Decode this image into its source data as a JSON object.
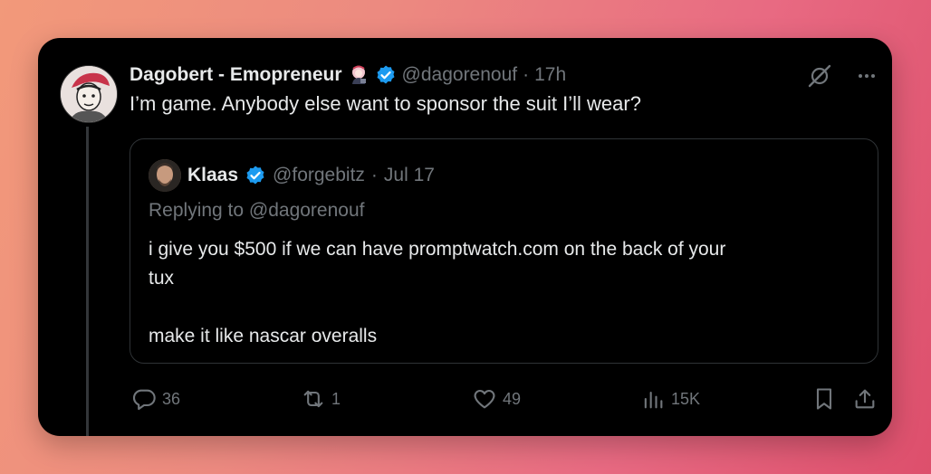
{
  "tweet": {
    "author_name": "Dagobert - Emopreneur",
    "handle": "@dagorenouf",
    "separator": "·",
    "time": "17h",
    "text": "I’m game. Anybody else want to sponsor the suit I’ll wear?"
  },
  "quote": {
    "author_name": "Klaas",
    "handle": "@forgebitz",
    "separator": "·",
    "date": "Jul 17",
    "replying_to": "Replying to @dagorenouf",
    "text_line1": "i give you $500 if we can have promptwatch.com on the back of your",
    "text_line2": "tux",
    "text_line3": "make it like nascar overalls"
  },
  "actions": {
    "replies": "36",
    "reposts": "1",
    "likes": "49",
    "views": "15K"
  },
  "icons": {
    "verified": "verified-badge-icon",
    "grok": "grok-icon",
    "more": "more-icon",
    "reply": "reply-icon",
    "repost": "repost-icon",
    "like": "like-icon",
    "views": "views-icon",
    "bookmark": "bookmark-icon",
    "share": "share-icon"
  },
  "colors": {
    "card_bg": "#000000",
    "text": "#e7e9ea",
    "muted": "#71767b",
    "verified_blue": "#1d9bf0",
    "border": "#2f3336"
  }
}
